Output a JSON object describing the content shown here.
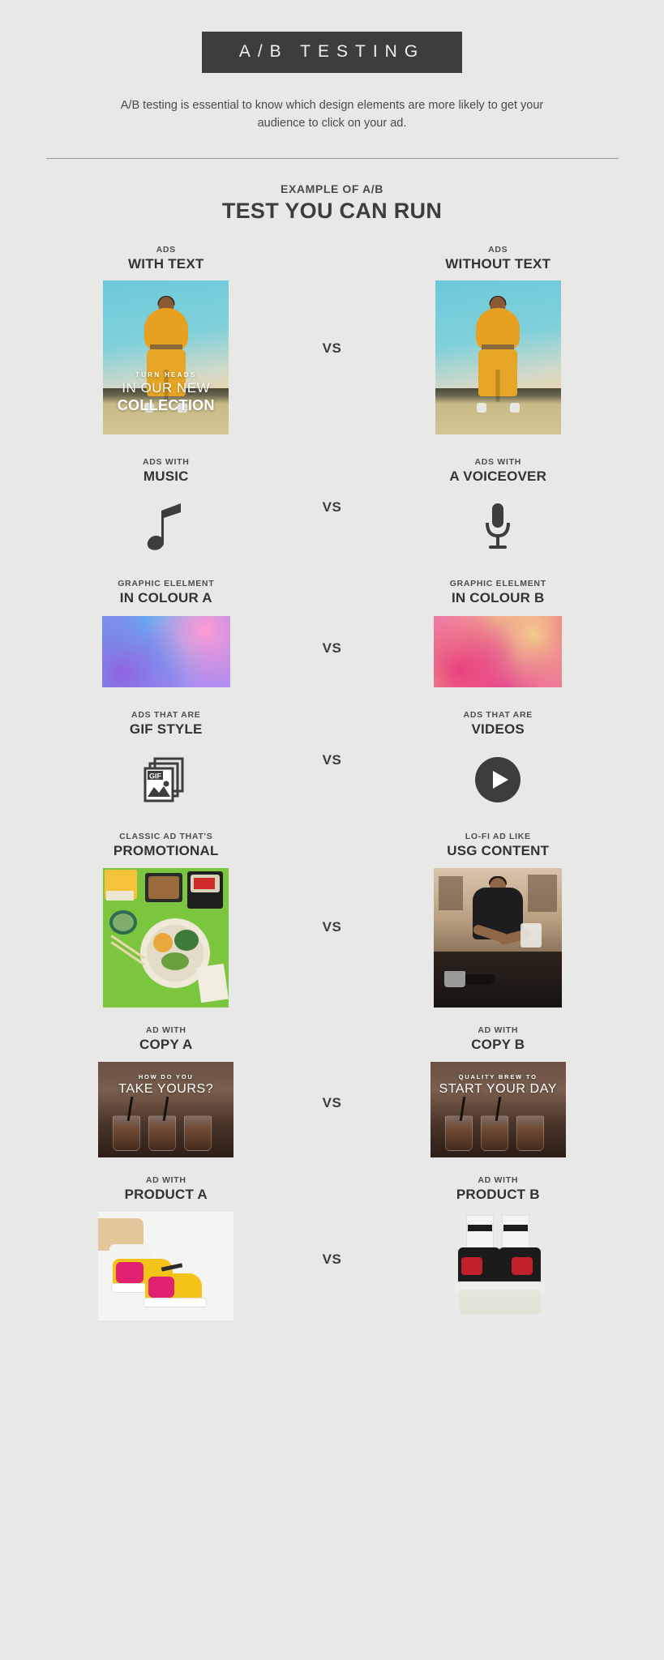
{
  "header": {
    "banner_title": "A/B TESTING",
    "subtitle": "A/B testing is essential to know which design elements are more likely to get your audience to click on your ad.",
    "section_kicker": "EXAMPLE OF A/B",
    "section_title": "TEST YOU CAN RUN"
  },
  "vs_label": "VS",
  "colors": {
    "background": "#e8e8e6",
    "banner_bg": "#3d3d3d",
    "banner_text": "#f0f0ee",
    "heading_text": "#3d3d3d",
    "body_text": "#4a4a4a",
    "divider": "#9a9a98",
    "gradient_a_start": "#7b8ef0",
    "gradient_a_end": "#b58ef0",
    "gradient_b_start": "#ef7fae",
    "gradient_b_end": "#e8468e",
    "food_bg": "#7bc53f",
    "model_jacket": "#e8a020"
  },
  "rows": [
    {
      "left": {
        "kicker": "ADS",
        "title": "WITH TEXT",
        "visual": "model-photo-with-text-overlay"
      },
      "right": {
        "kicker": "ADS",
        "title": "WITHOUT TEXT",
        "visual": "model-photo-plain"
      },
      "ad_overlay": {
        "line1": "TURN HEADS",
        "line2": "IN OUR NEW",
        "line3": "COLLECTION"
      }
    },
    {
      "left": {
        "kicker": "ADS WITH",
        "title": "MUSIC",
        "visual": "music-note-icon"
      },
      "right": {
        "kicker": "ADS WITH",
        "title": "A VOICEOVER",
        "visual": "microphone-icon"
      }
    },
    {
      "left": {
        "kicker": "GRAPHIC ELELMENT",
        "title": "IN COLOUR A",
        "visual": "gradient-blue-purple"
      },
      "right": {
        "kicker": "GRAPHIC ELELMENT",
        "title": "IN COLOUR B",
        "visual": "gradient-pink-coral"
      }
    },
    {
      "left": {
        "kicker": "ADS THAT ARE",
        "title": "GIF STYLE",
        "visual": "gif-file-icon"
      },
      "right": {
        "kicker": "ADS THAT ARE",
        "title": "VIDEOS",
        "visual": "play-button-icon"
      }
    },
    {
      "left": {
        "kicker": "CLASSIC AD THAT'S",
        "title": "PROMOTIONAL",
        "visual": "meal-flatlay-photo"
      },
      "right": {
        "kicker": "LO-FI AD LIKE",
        "title": "USG CONTENT",
        "visual": "kitchen-cooking-photo"
      }
    },
    {
      "left": {
        "kicker": "AD WITH",
        "title": "COPY A",
        "visual": "coffee-photo-copy-a",
        "overlay": {
          "line1": "HOW DO YOU",
          "line2": "TAKE YOURS?"
        }
      },
      "right": {
        "kicker": "AD WITH",
        "title": "COPY B",
        "visual": "coffee-photo-copy-b",
        "overlay": {
          "line1": "QUALITY BREW TO",
          "line2": "START YOUR DAY"
        }
      }
    },
    {
      "left": {
        "kicker": "AD WITH",
        "title": "PRODUCT A",
        "visual": "sneaker-pink-yellow-photo"
      },
      "right": {
        "kicker": "AD WITH",
        "title": "PRODUCT B",
        "visual": "sneaker-black-red-photo"
      }
    }
  ],
  "icons": {
    "music_note": "music-note-icon",
    "microphone": "microphone-icon",
    "gif_file": "gif-file-icon",
    "play_button": "play-button-icon"
  },
  "gif_icon_label": "GIF"
}
